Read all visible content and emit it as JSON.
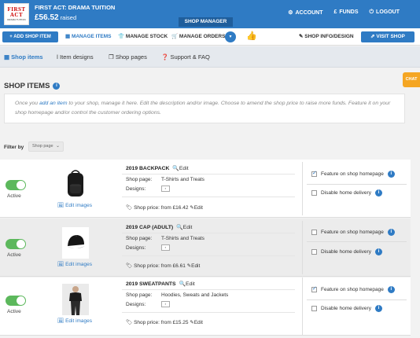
{
  "header": {
    "logo_line1": "FIRST",
    "logo_line2": "ACT",
    "logo_line3": "DRAMA TUITION",
    "shop_title": "FIRST ACT: DRAMA TUITION",
    "raised_amount": "£56.52",
    "raised_label": "raised",
    "shop_manager": "SHOP MANAGER",
    "links": [
      {
        "icon": "gear-icon",
        "label": "ACCOUNT"
      },
      {
        "icon": "pound-icon",
        "label": "FUNDS"
      },
      {
        "icon": "logout-icon",
        "label": "LOGOUT"
      }
    ]
  },
  "toolbar": {
    "add_shop_item": "ADD SHOP ITEM",
    "manage_items": "MANAGE ITEMS",
    "manage_stock": "MANAGE STOCK",
    "manage_orders": "MANAGE ORDERS",
    "shop_info": "SHOP INFO/DESIGN",
    "visit_shop": "VISIT SHOP"
  },
  "subnav": {
    "shop_items": "Shop items",
    "item_designs": "Item designs",
    "shop_pages": "Shop pages",
    "support": "Support & FAQ"
  },
  "page": {
    "title": "SHOP ITEMS",
    "chat": "CHAT",
    "desc_pre": "Once you ",
    "desc_link": "add an item",
    "desc_post": " to your shop, manage it here. Edit the description and/or image. Choose to amend the shop price to raise more funds. Feature it on your shop homepage and/or control the customer ordering options.",
    "filter_label": "Filter by",
    "filter_value": "Shop page"
  },
  "labels": {
    "active": "Active",
    "edit_images": "Edit images",
    "edit": "Edit",
    "shop_page": "Shop page:",
    "designs": "Designs:",
    "shop_price_prefix": "Shop price: from ",
    "feature": "Feature on shop homepage",
    "disable_delivery": "Disable home delivery"
  },
  "items": [
    {
      "name": "2019 BACKPACK",
      "shop_page": "T-Shirts and Treats",
      "price": "£16.42",
      "featured": true,
      "disable_delivery": false
    },
    {
      "name": "2019 CAP (ADULT)",
      "shop_page": "T-Shirts and Treats",
      "price": "£6.61",
      "featured": false,
      "disable_delivery": false
    },
    {
      "name": "2019 SWEATPANTS",
      "shop_page": "Hoodies, Sweats and Jackets",
      "price": "£15.25",
      "featured": true,
      "disable_delivery": false
    }
  ],
  "colors": {
    "brand": "#2f7bc4",
    "toggle_on": "#5cb85c",
    "chat": "#f5a623"
  }
}
